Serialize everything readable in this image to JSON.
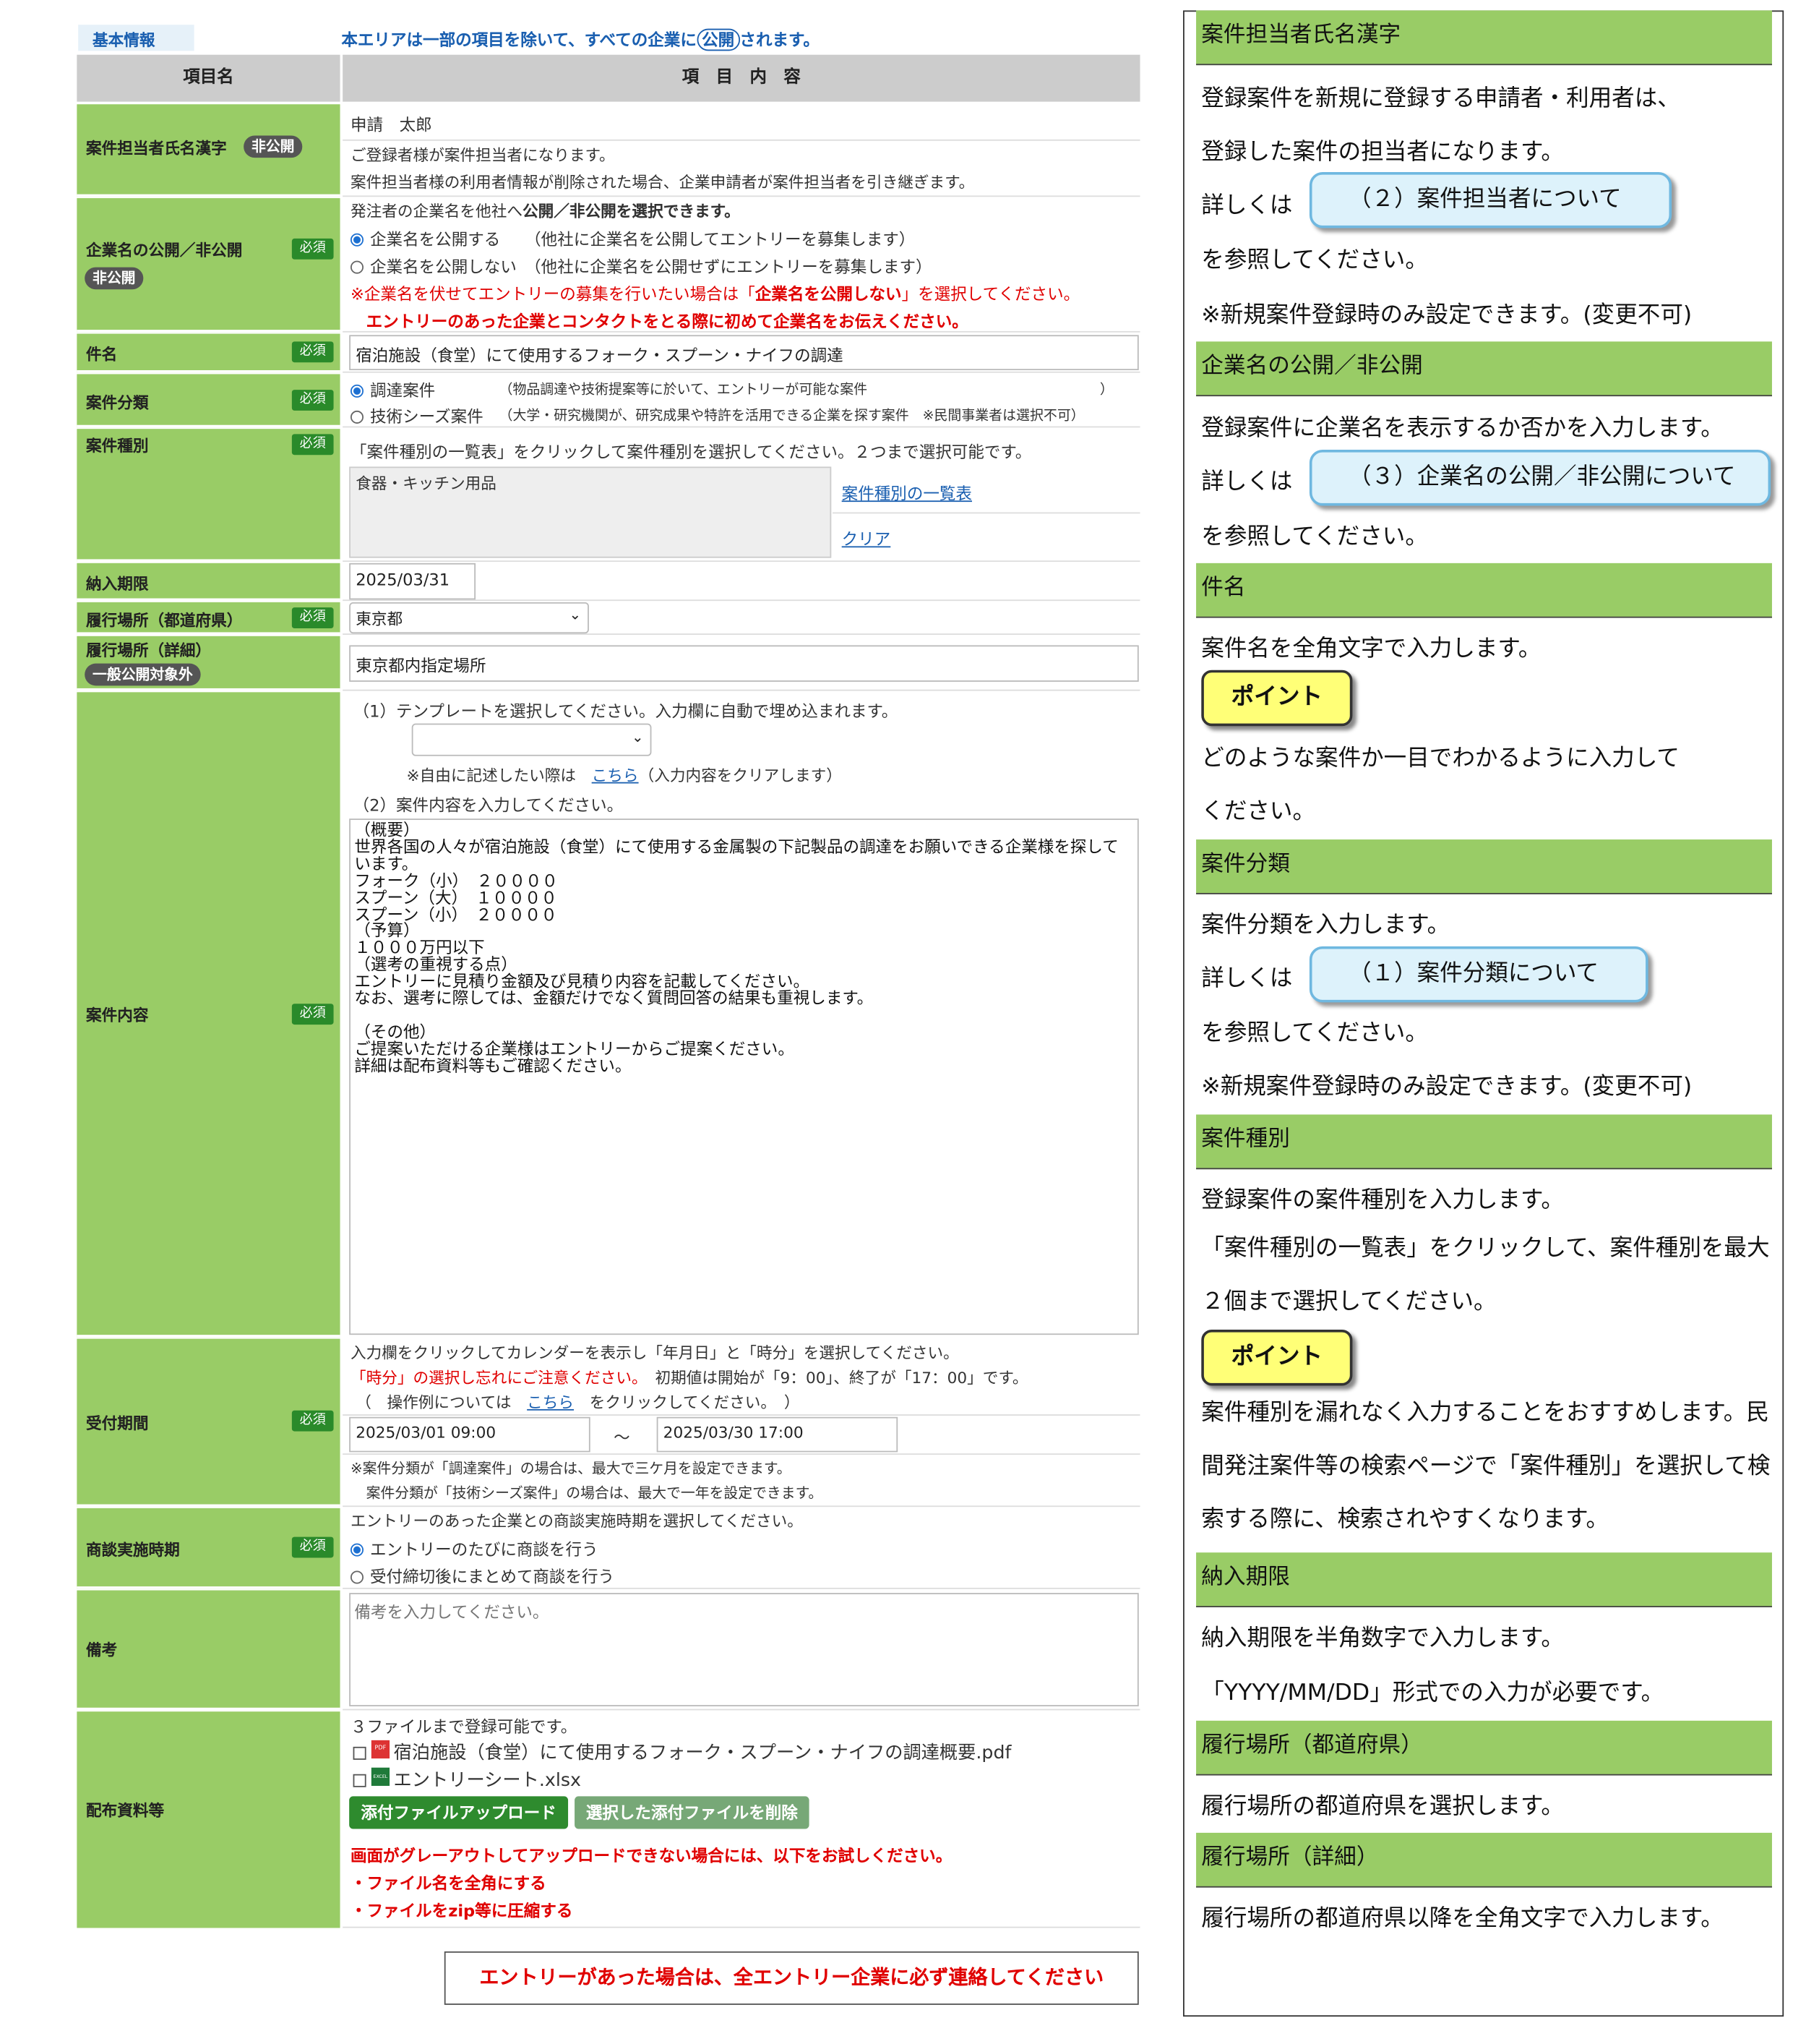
{
  "header": {
    "tab": "基本情報",
    "notice_a": "本エリアは一部の項目を除いて、すべての企業に",
    "notice_badge": "公開",
    "notice_b": "されます。"
  },
  "table_head": {
    "item": "項目名",
    "content": "項　目　内　容"
  },
  "badges": {
    "required": "必須",
    "private": "非公開",
    "not_public": "一般公開対象外"
  },
  "fields": {
    "person": {
      "label": "案件担当者氏名漢字",
      "value": "申請　太郎",
      "note1": "ご登録者様が案件担当者になります。",
      "note2": "案件担当者様の利用者情報が削除された場合、企業申請者が案件担当者を引き継ぎます。"
    },
    "company": {
      "label": "企業名の公開／非公開",
      "intro_a": "発注者の企業名を他社へ",
      "intro_b": "公開／非公開を選択できます。",
      "opt1": "企業名を公開する　　（他社に企業名を公開してエントリーを募集します）",
      "opt2": "企業名を公開しない　（他社に企業名を公開せずにエントリーを募集します）",
      "warn1_a": "※企業名を伏せてエントリーの募集を行いたい場合は「",
      "warn1_b": "企業名を公開しない",
      "warn1_c": "」を選択してください。",
      "warn2": "エントリーのあった企業とコンタクトをとる際に初めて企業名をお伝えください。"
    },
    "title": {
      "label": "件名",
      "value": "宿泊施設（食堂）にて使用するフォーク・スプーン・ナイフの調達"
    },
    "category": {
      "label": "案件分類",
      "opt1": "調達案件",
      "opt1_note": "（物品調達や技術提案等に於いて、エントリーが可能な案件　　　　　　　　　　　　　　　　　）",
      "opt2": "技術シーズ案件",
      "opt2_note": "（大学・研究機関が、研究成果や特許を活用できる企業を探す案件　※民間事業者は選択不可）"
    },
    "type": {
      "label": "案件種別",
      "intro": "「案件種別の一覧表」をクリックして案件種別を選択してください。２つまで選択可能です。",
      "selected": "食器・キッチン用品",
      "list_link": "案件種別の一覧表",
      "clear_link": "クリア"
    },
    "deadline": {
      "label": "納入期限",
      "value": "2025/03/31"
    },
    "pref": {
      "label": "履行場所（都道府県）",
      "value": "東京都"
    },
    "place": {
      "label": "履行場所（詳細）",
      "value": "東京都内指定場所"
    },
    "content": {
      "label": "案件内容",
      "step1": "（1）テンプレートを選択してください。入力欄に自動で埋め込まれます。",
      "free_a": "※自由に記述したい際は",
      "free_link": "こちら",
      "free_b": "（入力内容をクリアします）",
      "step2": "（2）案件内容を入力してください。",
      "body": "（概要）\n世界各国の人々が宿泊施設（食堂）にて使用する金属製の下記製品の調達をお願いできる企業様を探しています。\nフォーク（小）　２００００\nスプーン（大）　１００００\nスプーン（小）　２００００\n（予算）\n１０００万円以下\n（選考の重視する点）\nエントリーに見積り金額及び見積り内容を記載してください。\nなお、選考に際しては、金額だけでなく質問回答の結果も重視します。\n\n（その他）\nご提案いただける企業様はエントリーからご提案ください。\n詳細は配布資料等もご確認ください。"
    },
    "period": {
      "label": "受付期間",
      "note1": "入力欄をクリックしてカレンダーを表示し「年月日」と「時分」を選択してください。",
      "note2_red": "「時分」の選択し忘れにご注意ください。",
      "note2_b": "初期値は開始が「9：00」、終了が「17：00」です。",
      "note3_a": "（　操作例については",
      "note3_link": "こちら",
      "note3_b": "をクリックしてください。　）",
      "start": "2025/03/01 09:00",
      "tilde": "～",
      "end": "2025/03/30 17:00",
      "foot1": "※案件分類が「調達案件」の場合は、最大で三ケ月を設定できます。",
      "foot2": "案件分類が「技術シーズ案件」の場合は、最大で一年を設定できます。"
    },
    "meeting": {
      "label": "商談実施時期",
      "intro": "エントリーのあった企業との商談実施時期を選択してください。",
      "opt1": "エントリーのたびに商談を行う",
      "opt2": "受付締切後にまとめて商談を行う"
    },
    "remarks": {
      "label": "備考",
      "placeholder": "備考を入力してください。"
    },
    "files": {
      "label": "配布資料等",
      "intro": "３ファイルまで登録可能です。",
      "file1": "宿泊施設（食堂）にて使用するフォーク・スプーン・ナイフの調達概要.pdf",
      "file1_icon": "PDF",
      "file2": "エントリーシート.xlsx",
      "file2_icon": "EXCEL",
      "upload": "添付ファイルアップロード",
      "delete": "選択した添付ファイルを削除",
      "warn1": "画面がグレーアウトしてアップロードできない場合には、以下をお試しください。",
      "warn2": "・ファイル名を全角にする",
      "warn3": "・ファイルをzip等に圧縮する"
    }
  },
  "bottom_notice": "エントリーがあった場合は、全エントリー企業に必ず連絡してください",
  "help": {
    "s1": {
      "title": "案件担当者氏名漢字",
      "l1": "登録案件を新規に登録する申請者・利用者は、",
      "l2": "登録した案件の担当者になります。",
      "pre": "詳しくは",
      "ref": "（２）案件担当者について",
      "post": "を参照してください。",
      "note": "※新規案件登録時のみ設定できます。(変更不可)"
    },
    "s2": {
      "title": "企業名の公開／非公開",
      "l1": "登録案件に企業名を表示するか否かを入力します。",
      "pre": "詳しくは",
      "ref": "（３）企業名の公開／非公開について",
      "post": "を参照してください。"
    },
    "s3": {
      "title": "件名",
      "l1": "案件名を全角文字で入力します。",
      "point": "ポイント",
      "p1": "どのような案件か一目でわかるように入力して",
      "p2": "ください。"
    },
    "s4": {
      "title": "案件分類",
      "l1": "案件分類を入力します。",
      "pre": "詳しくは",
      "ref": "（１）案件分類について",
      "post": "を参照してください。",
      "note": "※新規案件登録時のみ設定できます。(変更不可)"
    },
    "s5": {
      "title": "案件種別",
      "l1": "登録案件の案件種別を入力します。",
      "l2": "「案件種別の一覧表」をクリックして、案件種別を最大２個まで選択してください。",
      "point": "ポイント",
      "p1": "案件種別を漏れなく入力することをおすすめします。民間発注案件等の検索ページで「案件種別」を選択して検索する際に、検索されやすくなります。"
    },
    "s6": {
      "title": "納入期限",
      "l1": "納入期限を半角数字で入力します。",
      "l2": "「YYYY/MM/DD」形式での入力が必要です。"
    },
    "s7": {
      "title": "履行場所（都道府県）",
      "l1": "履行場所の都道府県を選択します。"
    },
    "s8": {
      "title": "履行場所（詳細）",
      "l1": "履行場所の都道府県以降を全角文字で入力します。"
    }
  },
  "colors": {
    "label_bg": "#99cc66",
    "required_bg": "#2a8a2a",
    "header_bg": "#cccccc",
    "link": "#1a5fb0",
    "warn": "#e00000",
    "upload_btn": "#2e8b2e",
    "delete_btn": "#77a877",
    "ref_bg": "#ddf2fb",
    "point_bg": "#ffff77"
  }
}
